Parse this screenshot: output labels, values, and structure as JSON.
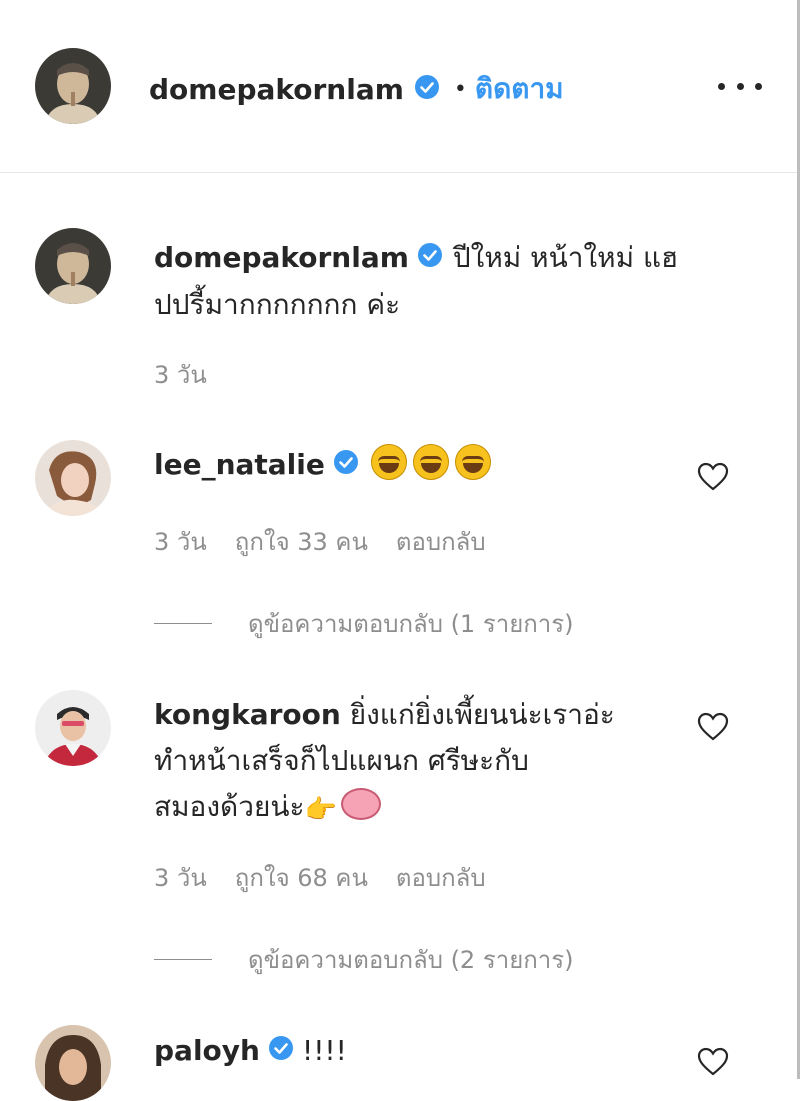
{
  "post": {
    "author": "domepakornlam",
    "follow_separator": "•",
    "follow_label": "ติดตาม",
    "more_label": "more-options",
    "caption": {
      "author": "domepakornlam",
      "text_line1": "ปีใหม่ หน้าใหม่ แฮ",
      "text_line2": "ปปรี้มากกกกกกก ค่ะ",
      "time": "3 วัน"
    }
  },
  "comments": [
    {
      "user": "lee_natalie",
      "verified": true,
      "time": "3 วัน",
      "likes": "ถูกใจ 33 คน",
      "reply": "ตอบกลับ",
      "view_replies": "ดูข้อความตอบกลับ (1 รายการ)"
    },
    {
      "user": "kongkaroon",
      "verified": false,
      "text_line1": "ยิ่งแก่ยิ่งเพี้ยนน่ะเราอ่ะ",
      "text_line2": "ทำหน้าเสร็จก็ไปแผนก ศรีษะกับ",
      "text_line3": "สมองด้วยน่ะ",
      "time": "3 วัน",
      "likes": "ถูกใจ 68 คน",
      "reply": "ตอบกลับ",
      "view_replies": "ดูข้อความตอบกลับ (2 รายการ)"
    },
    {
      "user": "paloyh",
      "verified": true,
      "text": "!!!!"
    }
  ],
  "colors": {
    "accent": "#3897f0",
    "verified": "#3897f0",
    "muted": "#8e8e8e",
    "text": "#262626"
  }
}
